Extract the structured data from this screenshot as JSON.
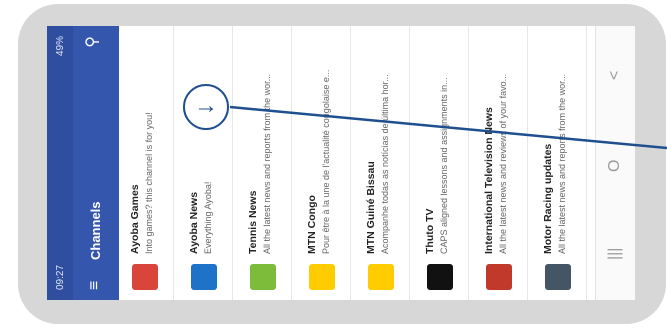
{
  "status_bar": {
    "time": "09:27",
    "indicators": "49%"
  },
  "app_bar": {
    "title": "Channels",
    "menu_icon": "hamburger-icon",
    "search_icon": "search-icon"
  },
  "channels": [
    {
      "title": "Ayoba Games",
      "subtitle": "Into games? this channel is for you!",
      "icon": "games-grid-icon",
      "color": "#d9453b"
    },
    {
      "title": "Ayoba News",
      "subtitle": "Everything Ayoba!",
      "icon": "ayoba-logo-icon",
      "color": "#1e73c8"
    },
    {
      "title": "Tennis News",
      "subtitle": "All the latest news and reports from the wor...",
      "icon": "tennis-icon",
      "color": "#7dbb3a"
    },
    {
      "title": "MTN Congo",
      "subtitle": "Pour être à la une de l'actualité congolaise e...",
      "icon": "mtn-logo-icon",
      "color": "#ffcc00"
    },
    {
      "title": "MTN Guiné Bissau",
      "subtitle": "Acompanhe todas as notícias de última hor...",
      "icon": "mtn-logo-icon",
      "color": "#ffcc00"
    },
    {
      "title": "Thuto TV",
      "subtitle": "CAPS aligned lessons and assignments in...",
      "icon": "thuto-tv-icon",
      "color": "#111111"
    },
    {
      "title": "International Television News",
      "subtitle": "All the latest news and reviews of your favo...",
      "icon": "tv-news-icon",
      "color": "#c0392b"
    },
    {
      "title": "Motor Racing updates",
      "subtitle": "All the latest news and reports from the wor...",
      "icon": "racing-icon",
      "color": "#445566"
    }
  ],
  "annotation": {
    "arrow_icon": "arrow-right-icon",
    "accent": "#1e4f8f"
  },
  "nav_bar": {
    "recent": "|||",
    "home": "O",
    "back": "<"
  }
}
